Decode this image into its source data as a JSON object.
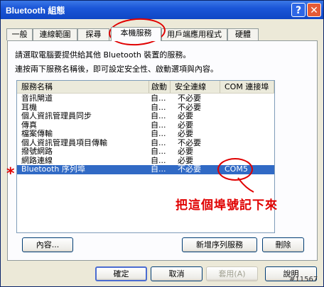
{
  "window": {
    "title": "Bluetooth 組態",
    "help_glyph": "?",
    "close_glyph": "✕"
  },
  "tabs": [
    {
      "label": "一般"
    },
    {
      "label": "連線範圍"
    },
    {
      "label": "探尋"
    },
    {
      "label": "本機服務",
      "active": true
    },
    {
      "label": "用戶端應用程式"
    },
    {
      "label": "硬體"
    }
  ],
  "description": {
    "line1": "請選取電腦要提供給其他 Bluetooth 裝置的服務。",
    "line2": "連按兩下服務名稱後，即可設定安全性、啟動選項與內容。"
  },
  "table": {
    "headers": [
      "服務名稱",
      "啟動",
      "安全連線",
      "COM 連接埠"
    ],
    "rows": [
      {
        "name": "音訊閘道",
        "start": "自...",
        "secure": "不必要",
        "com": ""
      },
      {
        "name": "耳機",
        "start": "自...",
        "secure": "不必要",
        "com": ""
      },
      {
        "name": "個人資訊管理員同步",
        "start": "自...",
        "secure": "必要",
        "com": ""
      },
      {
        "name": "傳真",
        "start": "自...",
        "secure": "必要",
        "com": ""
      },
      {
        "name": "檔案傳輸",
        "start": "自...",
        "secure": "必要",
        "com": ""
      },
      {
        "name": "個人資訊管理員項目傳輸",
        "start": "自...",
        "secure": "不必要",
        "com": ""
      },
      {
        "name": "撥號網路",
        "start": "自...",
        "secure": "必要",
        "com": ""
      },
      {
        "name": "網路連線",
        "start": "自...",
        "secure": "必要",
        "com": ""
      },
      {
        "name": "Bluetooth 序列埠",
        "start": "自...",
        "secure": "不必要",
        "com": "COM5",
        "selected": true
      }
    ]
  },
  "annotations": {
    "note": "把這個埠號記下來",
    "star": "*"
  },
  "buttons": {
    "properties": "內容...",
    "add_serial": "新增序列服務",
    "remove": "刪除",
    "ok": "確定",
    "cancel": "取消",
    "apply": "套用(A)",
    "help": "說明"
  },
  "watermark": "#11567",
  "colors": {
    "selection": "#316ac5",
    "annotation": "#e00000",
    "titlebar": "#1b56d8"
  }
}
